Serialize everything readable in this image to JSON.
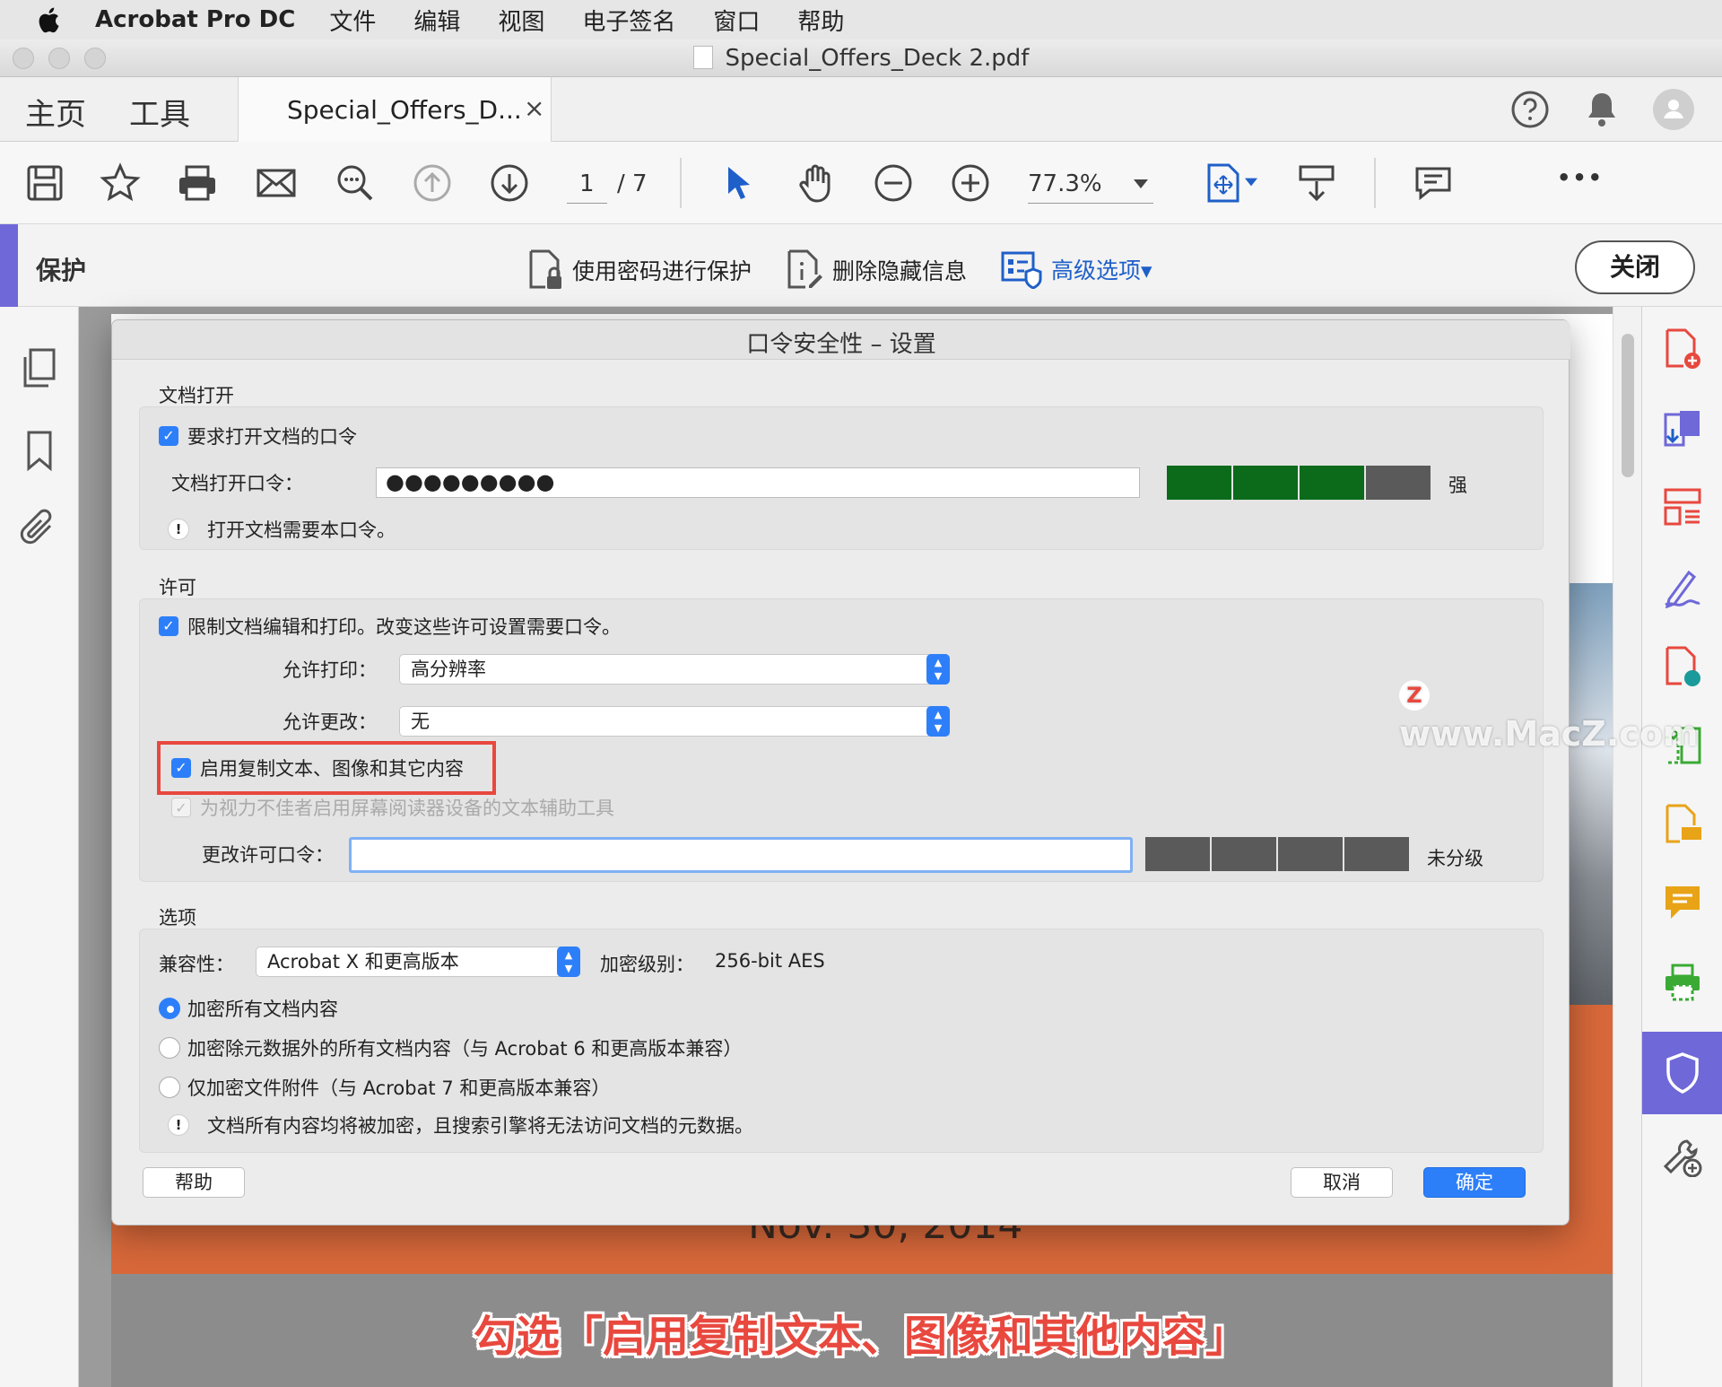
{
  "menubar": {
    "app_name": "Acrobat Pro DC",
    "items": [
      "文件",
      "编辑",
      "视图",
      "电子签名",
      "窗口",
      "帮助"
    ]
  },
  "window": {
    "title": "Special_Offers_Deck 2.pdf"
  },
  "tabs": {
    "home": "主页",
    "tools": "工具",
    "doc": "Special_Offers_D...",
    "close": "×"
  },
  "toolbar": {
    "page_current": "1",
    "page_total": "/ 7",
    "zoom": "77.3%",
    "more": "•••"
  },
  "protect": {
    "title": "保护",
    "encrypt_password": "使用密码进行保护",
    "remove_hidden": "删除隐藏信息",
    "advanced": "高级选项▾",
    "close": "关闭"
  },
  "page": {
    "date_text": "Nov. 30, 2014"
  },
  "dialog": {
    "title": "口令安全性 – 设置",
    "open": {
      "label": "文档打开",
      "require_cb": "要求打开文档的口令",
      "password_label": "文档打开口令：",
      "password_value": "●●●●●●●●●",
      "strength": "强",
      "note": "打开文档需要本口令。"
    },
    "perm": {
      "label": "许可",
      "restrict_cb": "限制文档编辑和打印。改变这些许可设置需要口令。",
      "print_label": "允许打印：",
      "print_value": "高分辨率",
      "change_label": "允许更改：",
      "change_value": "无",
      "copy_cb": "启用复制文本、图像和其它内容",
      "screenreader_cb": "为视力不佳者启用屏幕阅读器设备的文本辅助工具",
      "perm_password_label": "更改许可口令：",
      "perm_password_value": "",
      "strength": "未分级"
    },
    "options": {
      "label": "选项",
      "compat_label": "兼容性：",
      "compat_value": "Acrobat X 和更高版本",
      "enc_label": "加密级别：",
      "enc_value": "256-bit AES",
      "radio_all": "加密所有文档内容",
      "radio_except_meta": "加密除元数据外的所有文档内容（与 Acrobat 6 和更高版本兼容）",
      "radio_attachments": "仅加密文件附件（与 Acrobat 7 和更高版本兼容）",
      "note": "文档所有内容均将被加密，且搜索引擎将无法访问文档的元数据。"
    },
    "buttons": {
      "help": "帮助",
      "cancel": "取消",
      "ok": "确定"
    }
  },
  "overlay": {
    "watermark_letter": "Z",
    "watermark": "www.MacZ.com",
    "caption": "勾选「启用复制文本、图像和其他内容」"
  },
  "colors": {
    "accent": "#2d7ff9",
    "strong": "#0b6b1b",
    "highlight": "#e8483e",
    "protect_accent": "#6e68d8"
  }
}
